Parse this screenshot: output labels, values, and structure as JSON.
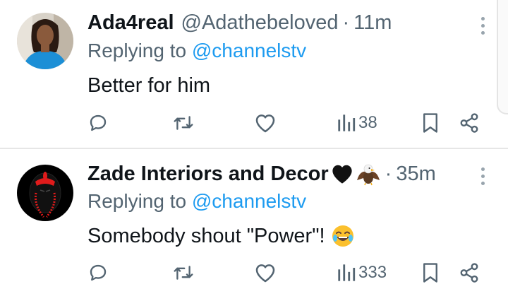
{
  "tweets": [
    {
      "name": "Ada4real",
      "handle": "@Adathebeloved",
      "separator": "·",
      "time": "11m",
      "replying_prefix": "Replying to",
      "replying_to": "@channelstv",
      "text": "Better for him",
      "views": "38"
    },
    {
      "name": "Zade Interiors and Decor",
      "handle": "",
      "separator": "·",
      "time": "35m",
      "replying_prefix": "Replying to",
      "replying_to": "@channelstv",
      "text": "Somebody shout \"Power\"!",
      "views": "333"
    }
  ],
  "icons": {
    "reply": "reply-icon",
    "retweet": "retweet-icon",
    "like": "heart-icon",
    "views": "views-icon",
    "bookmark": "bookmark-icon",
    "share": "share-icon",
    "more": "more-vertical-icon"
  },
  "colors": {
    "mention": "#1d9bf0",
    "secondary_text": "#536471",
    "primary_text": "#0f1419"
  }
}
